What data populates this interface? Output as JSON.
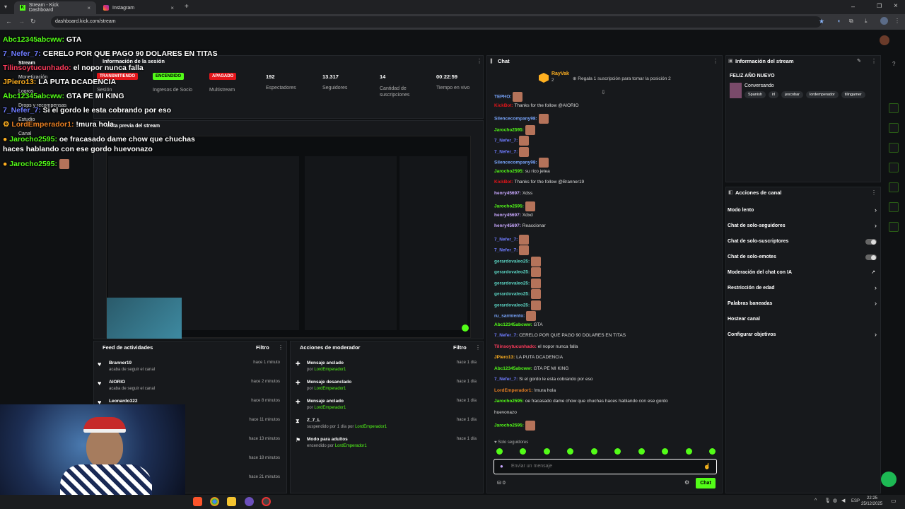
{
  "browser": {
    "tabs": [
      {
        "label": "Stream - Kick Dashboard"
      },
      {
        "label": "Instagram"
      }
    ],
    "url": "dashboard.kick.com/stream"
  },
  "session": {
    "title": "Información de la sesión",
    "items": [
      {
        "label": "TRANSMITIENDO",
        "sub": "Sesión",
        "color": "#e3151a"
      },
      {
        "label": "ENCENDIDO",
        "sub": "Ingresos de Socio",
        "color": "#53fc18"
      },
      {
        "label": "APAGADO",
        "sub": "Multistream",
        "color": "#e3151a"
      }
    ],
    "stats": [
      {
        "value": "192",
        "label": "Espectadores"
      },
      {
        "value": "13.317",
        "label": "Seguidores"
      },
      {
        "value": "14",
        "label": "Cantidad de suscripciones"
      },
      {
        "value": "00:22:59",
        "label": "Tiempo en vivo"
      }
    ]
  },
  "sidebar": {
    "items": [
      "Stream",
      "Monetización",
      "Logros",
      "Drops y recompensas",
      "Estudio",
      "Canal"
    ]
  },
  "preview": {
    "title": "Vista previa del stream"
  },
  "overlay_chat": [
    {
      "user": "Abc12345abcww:",
      "text": "GTA",
      "color": "#53fc18"
    },
    {
      "user": "7_Nefer_7:",
      "text": "CERELO POR QUE PAGO 90 DOLARES EN TITAS",
      "color": "#6f7cff"
    },
    {
      "user": "Tilinsoytucunhado:",
      "text": "el nopor nunca falla",
      "color": "#ff3b5c"
    },
    {
      "user": "JPiero13:",
      "text": "LA PUTA DCADENCIA",
      "color": "#ffb020"
    },
    {
      "user": "Abc12345abcww:",
      "text": "GTA PE MI KING",
      "color": "#53fc18"
    },
    {
      "user": "7_Nefer_7:",
      "text": "Si el gordo le esta cobrando por eso",
      "color": "#6f7cff"
    },
    {
      "user": "LordEmperador1:",
      "text": "!mura hola",
      "color": "#e67e22"
    },
    {
      "user": "Jarocho2595:",
      "text": "oe fracasado dame chow que chuchas haces hablando con ese gordo huevonazo",
      "color": "#53fc18"
    },
    {
      "user": "Jarocho2595:",
      "text": "",
      "color": "#53fc18"
    }
  ],
  "activity_feed": {
    "title": "Feed de actividades",
    "filter": "Filtro",
    "items": [
      {
        "name": "Branner19",
        "sub": "acaba de seguir el canal",
        "time": "hace 1 minuto"
      },
      {
        "name": "AIORIO",
        "sub": "acaba de seguir el canal",
        "time": "hace 2 minutos"
      },
      {
        "name": "Leonardo322",
        "sub": "",
        "time": "hace 8 minutos"
      },
      {
        "name": "",
        "sub": "",
        "time": "hace 11 minutos"
      },
      {
        "name": "",
        "sub": "",
        "time": "hace 13 minutos"
      },
      {
        "name": "",
        "sub": "",
        "time": "hace 18 minutos"
      },
      {
        "name": "",
        "sub": "",
        "time": "hace 21 minutos"
      }
    ]
  },
  "mod_actions": {
    "title": "Acciones de moderador",
    "filter": "Filtro",
    "items": [
      {
        "title": "Mensaje anclado",
        "pre": "por",
        "by": "LordEmperador1",
        "time": "hace 1 día"
      },
      {
        "title": "Mensaje desanclado",
        "pre": "por",
        "by": "LordEmperador1",
        "time": "hace 1 día"
      },
      {
        "title": "Mensaje anclado",
        "pre": "por",
        "by": "LordEmperador1",
        "time": "hace 1 día"
      },
      {
        "title": "Z_7_L",
        "pre": "suspendido por 1 día por",
        "by": "LordEmperador1",
        "time": "hace 1 día"
      },
      {
        "title": "Modo para adultos",
        "pre": "encendido por",
        "by": "LordEmperador1",
        "time": "hace 1 día"
      }
    ]
  },
  "chat": {
    "title": "Chat",
    "pinned_user": "RayVak",
    "pinned_count": "2",
    "gift_text": "Regala 1 suscripción para tomar la posición 2",
    "messages": [
      {
        "user": "TEPHO:",
        "text": "",
        "color": "#7aa7ff",
        "emote": true
      },
      {
        "user": "KickBot:",
        "text": "Thanks for the follow @AIORIO",
        "color": "#e3151a",
        "emote": false
      },
      {
        "user": "Silencecompany98:",
        "text": "",
        "color": "#7aa7ff",
        "emote": true
      },
      {
        "user": "Jarocho2595:",
        "text": "",
        "color": "#53fc18",
        "emote": true
      },
      {
        "user": "7_Nefer_7:",
        "text": "",
        "color": "#6f7cff",
        "emote": true
      },
      {
        "user": "7_Nefer_7:",
        "text": "",
        "color": "#6f7cff",
        "emote": true
      },
      {
        "user": "Silencecompany98:",
        "text": "",
        "color": "#7aa7ff",
        "emote": true
      },
      {
        "user": "Jarocho2595:",
        "text": "su rico jetea",
        "color": "#53fc18",
        "emote": false
      },
      {
        "user": "KickBot:",
        "text": "Thanks for the follow @Branner19",
        "color": "#e3151a",
        "emote": false
      },
      {
        "user": "henry45697:",
        "text": "Xdss",
        "color": "#c9a8ff",
        "emote": false
      },
      {
        "user": "Jarocho2595:",
        "text": "",
        "color": "#53fc18",
        "emote": true
      },
      {
        "user": "henry45697:",
        "text": "Xdxd",
        "color": "#c9a8ff",
        "emote": false
      },
      {
        "user": "henry45697:",
        "text": "Reaccionar",
        "color": "#c9a8ff",
        "emote": false
      },
      {
        "user": "7_Nefer_7:",
        "text": "",
        "color": "#6f7cff",
        "emote": true
      },
      {
        "user": "7_Nefer_7:",
        "text": "",
        "color": "#6f7cff",
        "emote": true
      },
      {
        "user": "gerardovaleo25:",
        "text": "",
        "color": "#5ad1c0",
        "emote": true
      },
      {
        "user": "gerardovaleo25:",
        "text": "",
        "color": "#5ad1c0",
        "emote": true
      },
      {
        "user": "gerardovaleo25:",
        "text": "",
        "color": "#5ad1c0",
        "emote": true
      },
      {
        "user": "gerardovaleo25:",
        "text": "",
        "color": "#5ad1c0",
        "emote": true
      },
      {
        "user": "gerardovaleo25:",
        "text": "",
        "color": "#5ad1c0",
        "emote": true
      },
      {
        "user": "ru_sarmiento:",
        "text": "",
        "color": "#7aa7ff",
        "emote": true
      },
      {
        "user": "Abc12345abcww:",
        "text": "GTA",
        "color": "#53fc18",
        "emote": false
      },
      {
        "user": "7_Nefer_7:",
        "text": "CERELO POR QUE PAGO 90 DOLARES EN TITAS",
        "color": "#6f7cff",
        "emote": false
      },
      {
        "user": "Tilinsoytucunhado:",
        "text": "el nopor nunca falla",
        "color": "#ff3b5c",
        "emote": false
      },
      {
        "user": "JPiero13:",
        "text": "LA PUTA DCADENCIA",
        "color": "#ffb020",
        "emote": false
      },
      {
        "user": "Abc12345abcww:",
        "text": "GTA PE MI KING",
        "color": "#53fc18",
        "emote": false
      },
      {
        "user": "7_Nefer_7:",
        "text": "Si el gordo le esta cobrando por eso",
        "color": "#6f7cff",
        "emote": false
      },
      {
        "user": "LordEmperador1:",
        "text": "!mura hola",
        "color": "#e67e22",
        "emote": false
      },
      {
        "user": "Jarocho2595:",
        "text": "oe fracasado dame chow que chuchas haces hablando con ese gordo",
        "color": "#53fc18",
        "emote": false
      },
      {
        "user": "",
        "text": "huevonazo",
        "color": "#53fc18",
        "emote": false
      },
      {
        "user": "Jarocho2595:",
        "text": "",
        "color": "#53fc18",
        "emote": true
      }
    ],
    "followers_only": "Solo seguidores",
    "input_placeholder": "Enviar un mensaje",
    "count": "0",
    "send_label": "Chat"
  },
  "stream_info": {
    "title": "Información del stream",
    "stream_title": "FELIZ AÑO NUEVO",
    "category": "Conversando",
    "tags": [
      "Spanish",
      "irl",
      "jescobar",
      "lordemperador",
      "tilingamer"
    ]
  },
  "channel_actions": {
    "title": "Acciones de canal",
    "items": [
      {
        "label": "Modo lento",
        "control": "chevron"
      },
      {
        "label": "Chat de solo-seguidores",
        "control": "chevron"
      },
      {
        "label": "Chat de solo-suscriptores",
        "control": "toggle"
      },
      {
        "label": "Chat de solo-emotes",
        "control": "toggle"
      },
      {
        "label": "Moderación del chat con IA",
        "control": "external"
      },
      {
        "label": "Restricción de edad",
        "control": "chevron"
      },
      {
        "label": "Palabras baneadas",
        "control": "chevron"
      },
      {
        "label": "Hostear canal",
        "control": "none"
      },
      {
        "label": "Configurar objetivos",
        "control": "chevron"
      }
    ]
  },
  "taskbar": {
    "lang": "ESP",
    "time": "22:25",
    "date": "25/12/2025"
  },
  "colors": {
    "accent": "#53fc18",
    "danger": "#e3151a"
  }
}
